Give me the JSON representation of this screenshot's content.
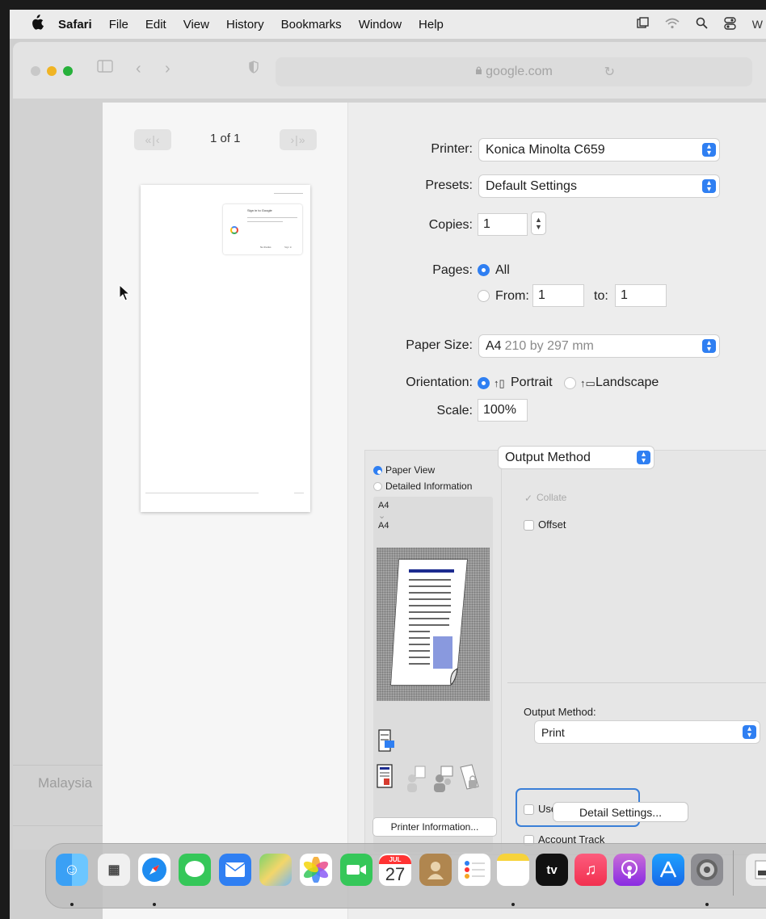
{
  "menubar": {
    "app_name": "Safari",
    "items": [
      "File",
      "Edit",
      "View",
      "History",
      "Bookmarks",
      "Window",
      "Help"
    ],
    "trailing": "W"
  },
  "safari": {
    "url": "google.com",
    "background_text": "Malaysia"
  },
  "preview": {
    "page_indicator": "1 of 1",
    "thumb_card_title": "Sign in to Google",
    "thumb_card_buttons": [
      "No thanks",
      "Sign in"
    ]
  },
  "print": {
    "printer_label": "Printer:",
    "printer_value": "Konica Minolta C659",
    "presets_label": "Presets:",
    "presets_value": "Default Settings",
    "copies_label": "Copies:",
    "copies_value": "1",
    "pages_label": "Pages:",
    "pages_all": "All",
    "pages_from_label": "From:",
    "pages_from_value": "1",
    "pages_to_label": "to:",
    "pages_to_value": "1",
    "paper_size_label": "Paper Size:",
    "paper_size_value": "A4",
    "paper_size_detail": "210 by 297 mm",
    "orientation_label": "Orientation:",
    "orientation_portrait": "Portrait",
    "orientation_landscape": "Landscape",
    "scale_label": "Scale:",
    "scale_value": "100%",
    "section_popup": "Output Method"
  },
  "panel": {
    "view_paper": "Paper View",
    "view_detailed": "Detailed Information",
    "paper_from": "A4",
    "paper_to": "A4",
    "collate": "Collate",
    "offset": "Offset",
    "output_method_label": "Output Method:",
    "output_method_value": "Print",
    "user_auth": "User Authentication",
    "account_track": "Account Track",
    "printer_info_button": "Printer Information...",
    "detail_settings_button": "Detail Settings..."
  },
  "dock": {
    "calendar_month": "JUL",
    "calendar_day": "27",
    "tv_label": "tv"
  },
  "colors": {
    "accent": "#2f7ff2",
    "focus_ring": "#3a7fd8"
  }
}
